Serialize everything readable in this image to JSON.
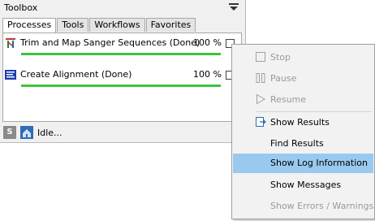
{
  "toolbox": {
    "title": "Toolbox",
    "tabs": [
      {
        "label": "Processes"
      },
      {
        "label": "Tools"
      },
      {
        "label": "Workflows"
      },
      {
        "label": "Favorites"
      }
    ],
    "processes": [
      {
        "name": "Trim and Map Sanger Sequences (Done)",
        "percent": "100 %",
        "progress": 1.0,
        "icon": "workflow-icon"
      },
      {
        "name": "Create Alignment (Done)",
        "percent": "100 %",
        "progress": 1.0,
        "icon": "alignment-icon"
      }
    ],
    "status": {
      "text": "Idle..."
    },
    "progress_color": "#3cc43c"
  },
  "context_menu": {
    "items": [
      {
        "label": "Stop",
        "enabled": false,
        "icon": "stop-icon"
      },
      {
        "label": "Pause",
        "enabled": false,
        "icon": "pause-icon"
      },
      {
        "label": "Resume",
        "enabled": false,
        "icon": "resume-icon"
      },
      {
        "label": "Show Results",
        "enabled": true,
        "icon": "show-results-icon"
      },
      {
        "label": "Find Results",
        "enabled": true
      },
      {
        "label": "Show Log Information",
        "enabled": true,
        "highlighted": true
      },
      {
        "label": "Show Messages",
        "enabled": true
      },
      {
        "label": "Show Errors / Warnings",
        "enabled": false
      }
    ],
    "highlight_color": "#99c9ef"
  }
}
